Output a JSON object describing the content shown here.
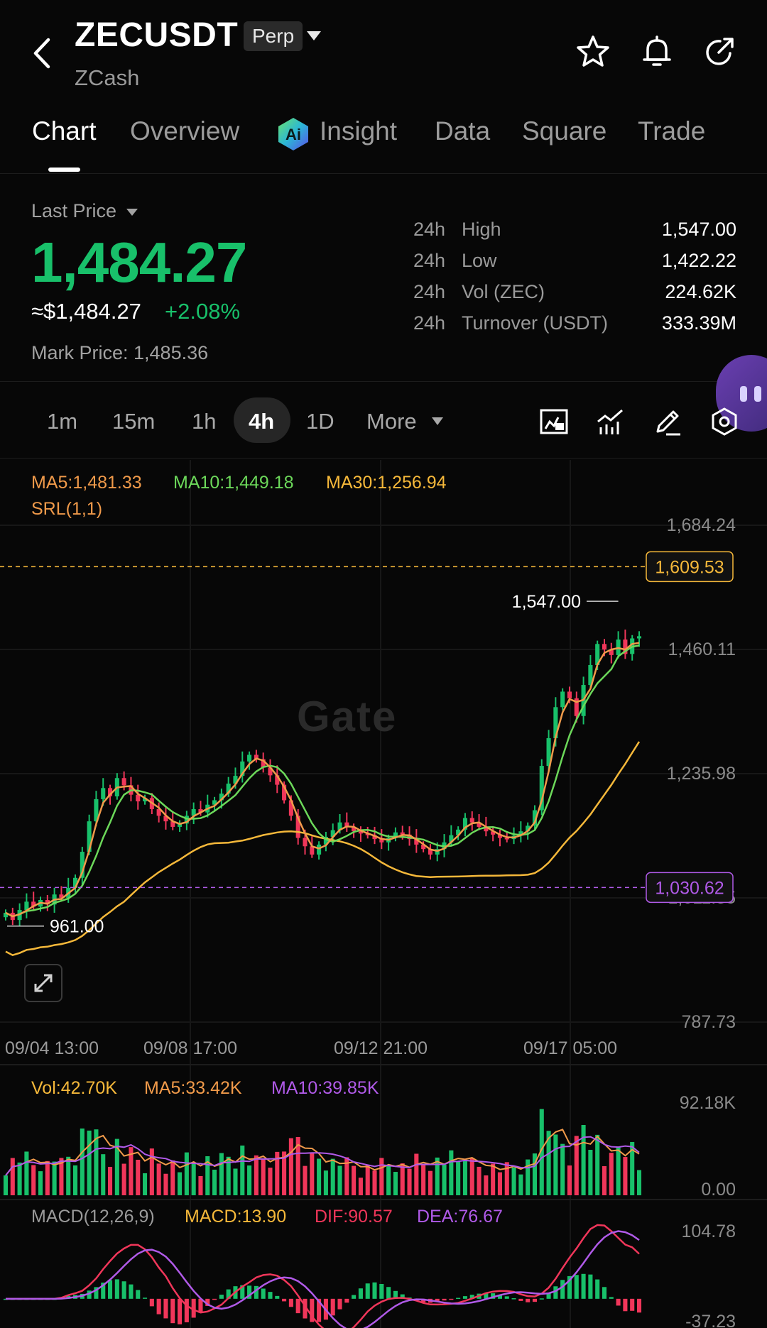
{
  "header": {
    "pair": "ZECUSDT",
    "contract_type": "Perp",
    "name": "ZCash"
  },
  "tabs": [
    {
      "label": "Chart",
      "active": true
    },
    {
      "label": "Overview"
    },
    {
      "label": "Insight"
    },
    {
      "label": "Data"
    },
    {
      "label": "Square"
    },
    {
      "label": "Trade"
    }
  ],
  "price": {
    "last_price_label": "Last Price",
    "last_price": "1,484.27",
    "usd_price": "≈$1,484.27",
    "change_pct": "+2.08%",
    "mark_price": "Mark Price: 1,485.36"
  },
  "stats": [
    {
      "period": "24h",
      "label": "High",
      "value": "1,547.00"
    },
    {
      "period": "24h",
      "label": "Low",
      "value": "1,422.22"
    },
    {
      "period": "24h",
      "label": "Vol (ZEC)",
      "value": "224.62K"
    },
    {
      "period": "24h",
      "label": "Turnover (USDT)",
      "value": "333.39M"
    }
  ],
  "timeframes": {
    "items": [
      "1m",
      "15m",
      "1h",
      "4h",
      "1D"
    ],
    "active": "4h",
    "more_label": "More"
  },
  "indicators": {
    "ma5": "MA5:1,481.33",
    "ma10": "MA10:1,449.18",
    "ma30": "MA30:1,256.94",
    "srl": "SRL(1,1)",
    "vol": "Vol:42.70K",
    "vol_ma5": "MA5:33.42K",
    "vol_ma10": "MA10:39.85K",
    "macd_params": "MACD(12,26,9)",
    "macd": "MACD:13.90",
    "dif": "DIF:90.57",
    "dea": "DEA:76.67"
  },
  "watermark": "Gate",
  "colors": {
    "up": "#18c06a",
    "down": "#f0365a",
    "ma5": "#f09a4a",
    "ma10": "#6cd85a",
    "ma30": "#f5b83a",
    "purple": "#b05ae8",
    "accent_green": "#18c06a"
  },
  "chart_data": {
    "type": "candlestick",
    "price_axis": {
      "min": 787.73,
      "max": 1684.24,
      "ticks": [
        1684.24,
        1460.11,
        1235.98,
        1011.85,
        787.73
      ],
      "tick_labels": [
        "1,684.24",
        "1,460.11",
        "1,235.98",
        "1,011.85",
        "787.73"
      ]
    },
    "time_labels": [
      "09/04 13:00",
      "09/08 17:00",
      "09/12 21:00",
      "09/17 05:00"
    ],
    "price_lines": [
      {
        "value": 1609.53,
        "label": "1,609.53",
        "color": "#f5b83a"
      },
      {
        "value": 1030.62,
        "label": "1,030.62",
        "color": "#b05ae8"
      }
    ],
    "annotations": [
      {
        "label": "1,547.00",
        "value": 1547.0,
        "type": "high"
      },
      {
        "label": "961.00",
        "value": 961.0,
        "type": "low"
      }
    ],
    "candle_close_series": [
      985,
      972,
      990,
      1005,
      996,
      1008,
      1000,
      1018,
      1012,
      1030,
      1048,
      1095,
      1150,
      1190,
      1210,
      1195,
      1228,
      1215,
      1198,
      1186,
      1192,
      1172,
      1160,
      1150,
      1140,
      1146,
      1160,
      1172,
      1166,
      1180,
      1188,
      1200,
      1218,
      1232,
      1258,
      1270,
      1262,
      1247,
      1233,
      1216,
      1188,
      1160,
      1120,
      1105,
      1090,
      1108,
      1122,
      1134,
      1148,
      1140,
      1132,
      1128,
      1125,
      1118,
      1112,
      1120,
      1130,
      1126,
      1118,
      1108,
      1100,
      1090,
      1100,
      1112,
      1125,
      1135,
      1156,
      1148,
      1140,
      1132,
      1126,
      1120,
      1118,
      1124,
      1132,
      1142,
      1170,
      1250,
      1300,
      1356,
      1384,
      1372,
      1340,
      1396,
      1432,
      1470,
      1460,
      1450,
      1478,
      1452,
      1480,
      1484
    ],
    "volume_axis": {
      "min": 0.0,
      "max": 92.18,
      "unit": "K",
      "tick_labels": [
        "92.18K",
        "0.00"
      ]
    },
    "macd_axis": {
      "min": -37.23,
      "max": 104.78,
      "tick_labels": [
        "104.78",
        "-37.23"
      ]
    }
  }
}
